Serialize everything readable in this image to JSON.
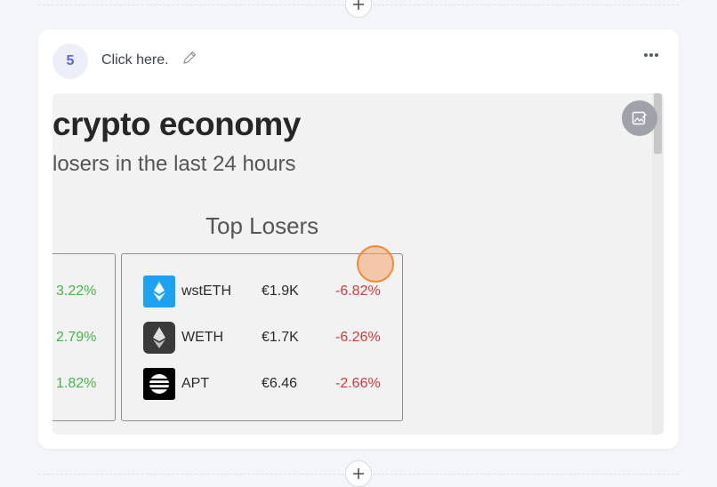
{
  "step": {
    "number": "5",
    "instruction": "Click here.",
    "icons": {
      "edit": "pencil-icon",
      "more": "more-options-icon",
      "image": "edit-image-icon",
      "add": "plus-icon"
    }
  },
  "screenshot": {
    "headline": "crypto economy",
    "subheadline": "losers in the last 24 hours",
    "panel_title": "Top Losers",
    "gainers_column": [
      "3.22%",
      "2.79%",
      "1.82%"
    ],
    "losers": [
      {
        "symbol": "wstETH",
        "price": "€1.9K",
        "change": "-6.82%",
        "icon": "wsteth-logo-icon"
      },
      {
        "symbol": "WETH",
        "price": "€1.7K",
        "change": "-6.26%",
        "icon": "weth-logo-icon"
      },
      {
        "symbol": "APT",
        "price": "€6.46",
        "change": "-2.66%",
        "icon": "apt-logo-icon"
      }
    ],
    "colors": {
      "positive": "#46b548",
      "negative": "#d33a3a",
      "click_marker": "#f28b34"
    }
  }
}
